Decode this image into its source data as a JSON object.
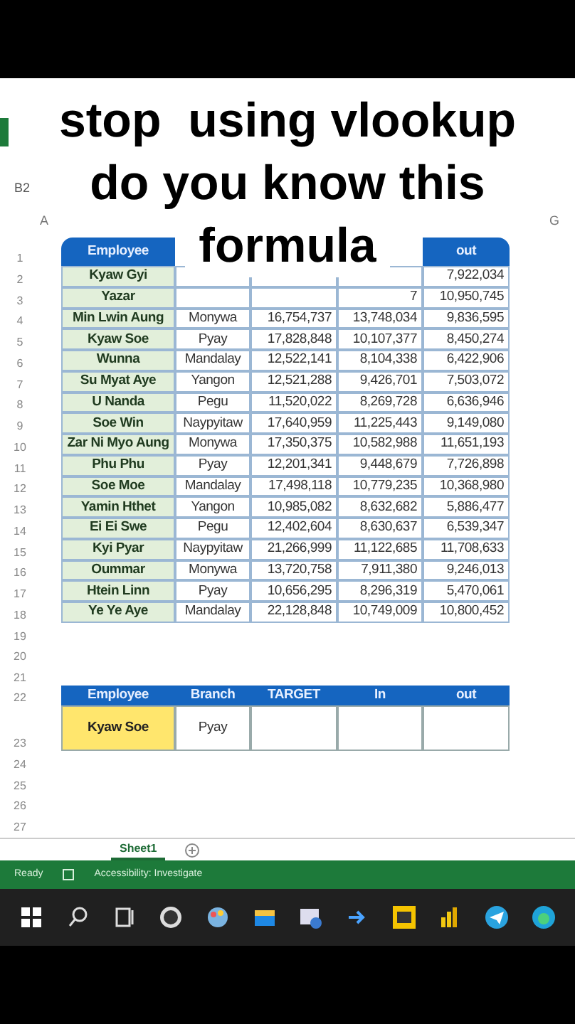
{
  "caption": [
    "stop  using vlookup",
    "do you know this",
    "formula"
  ],
  "name_box": "B2",
  "column_headers": [
    "A",
    "G"
  ],
  "sheet_rows": [
    {
      "number": "1",
      "kind": "header",
      "cells": [
        "Employee",
        null,
        null,
        null,
        "out"
      ]
    },
    {
      "number": "2",
      "kind": "data",
      "cells": [
        "Kyaw Gyi",
        null,
        null,
        null,
        "7,922,034"
      ]
    },
    {
      "number": "3",
      "kind": "data",
      "cells": [
        "Yazar",
        null,
        null,
        "7",
        "10,950,745"
      ]
    },
    {
      "number": "4",
      "kind": "data",
      "cells": [
        "Min Lwin Aung",
        "Monywa",
        "16,754,737",
        "13,748,034",
        "9,836,595"
      ]
    },
    {
      "number": "5",
      "kind": "data",
      "cells": [
        "Kyaw Soe",
        "Pyay",
        "17,828,848",
        "10,107,377",
        "8,450,274"
      ]
    },
    {
      "number": "6",
      "kind": "data",
      "cells": [
        "Wunna",
        "Mandalay",
        "12,522,141",
        "8,104,338",
        "6,422,906"
      ]
    },
    {
      "number": "7",
      "kind": "data",
      "cells": [
        "Su Myat Aye",
        "Yangon",
        "12,521,288",
        "9,426,701",
        "7,503,072"
      ]
    },
    {
      "number": "8",
      "kind": "data",
      "cells": [
        "U Nanda",
        "Pegu",
        "11,520,022",
        "8,269,728",
        "6,636,946"
      ]
    },
    {
      "number": "9",
      "kind": "data",
      "cells": [
        "Soe Win",
        "Naypyitaw",
        "17,640,959",
        "11,225,443",
        "9,149,080"
      ]
    },
    {
      "number": "10",
      "kind": "data",
      "cells": [
        "Zar Ni Myo Aung",
        "Monywa",
        "17,350,375",
        "10,582,988",
        "11,651,193"
      ]
    },
    {
      "number": "11",
      "kind": "data",
      "cells": [
        "Phu Phu",
        "Pyay",
        "12,201,341",
        "9,448,679",
        "7,726,898"
      ]
    },
    {
      "number": "12",
      "kind": "data",
      "cells": [
        "Soe Moe",
        "Mandalay",
        "17,498,118",
        "10,779,235",
        "10,368,980"
      ]
    },
    {
      "number": "13",
      "kind": "data",
      "cells": [
        "Yamin Hthet",
        "Yangon",
        "10,985,082",
        "8,632,682",
        "5,886,477"
      ]
    },
    {
      "number": "14",
      "kind": "data",
      "cells": [
        "Ei Ei Swe",
        "Pegu",
        "12,402,604",
        "8,630,637",
        "6,539,347"
      ]
    },
    {
      "number": "15",
      "kind": "data",
      "cells": [
        "Kyi Pyar",
        "Naypyitaw",
        "21,266,999",
        "11,122,685",
        "11,708,633"
      ]
    },
    {
      "number": "16",
      "kind": "data",
      "cells": [
        "Oummar",
        "Monywa",
        "13,720,758",
        "7,911,380",
        "9,246,013"
      ]
    },
    {
      "number": "17",
      "kind": "data",
      "cells": [
        "Htein Linn",
        "Pyay",
        "10,656,295",
        "8,296,319",
        "5,470,061"
      ]
    },
    {
      "number": "18",
      "kind": "data",
      "cells": [
        "Ye Ye Aye",
        "Mandalay",
        "22,128,848",
        "10,749,009",
        "10,800,452"
      ]
    },
    {
      "number": "19",
      "kind": "blank",
      "cells": []
    },
    {
      "number": "20",
      "kind": "blank",
      "cells": []
    },
    {
      "number": "21",
      "kind": "blank",
      "cells": []
    },
    {
      "number": "22",
      "kind": "header2",
      "cells": [
        "Employee",
        "Branch",
        "TARGET",
        "In",
        "out"
      ]
    },
    {
      "number": "23",
      "kind": "lookup",
      "cells": [
        "Kyaw Soe",
        "Pyay",
        null,
        null,
        null
      ]
    },
    {
      "number": "24",
      "kind": "blank",
      "cells": []
    },
    {
      "number": "25",
      "kind": "blank",
      "cells": []
    },
    {
      "number": "26",
      "kind": "blank",
      "cells": []
    },
    {
      "number": "27",
      "kind": "blank",
      "cells": []
    }
  ],
  "sheet_tabs": [
    {
      "label": "Sheet1",
      "selected": true
    }
  ],
  "status_bar": {
    "mode": "Ready",
    "accessibility": "Accessibility: Investigate"
  }
}
